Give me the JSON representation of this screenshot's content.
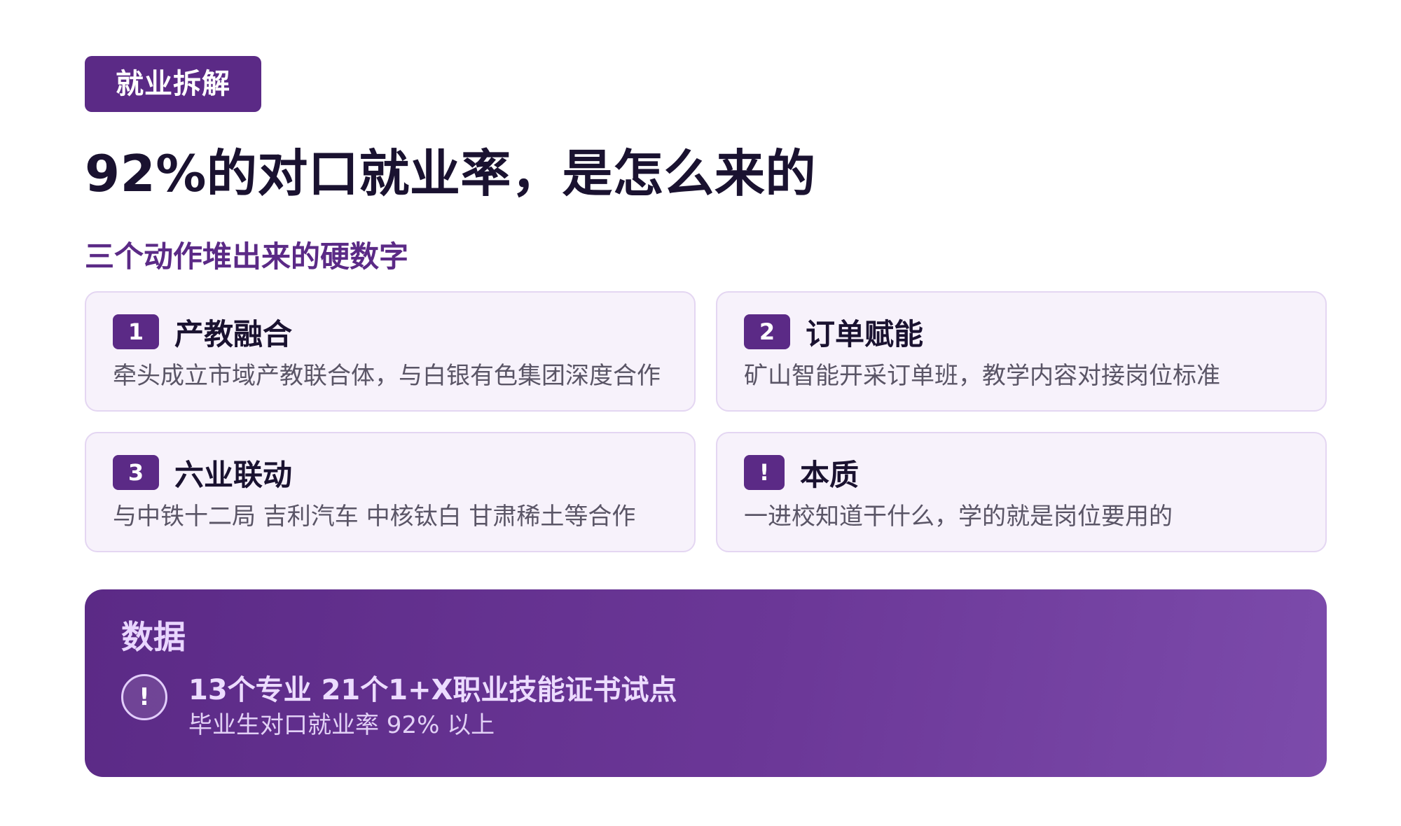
{
  "header": {
    "tag": "就业拆解",
    "title": "92%的对口就业率，是怎么来的",
    "subtitle": "三个动作堆出来的硬数字"
  },
  "cards": [
    {
      "badge": "1",
      "title": "产教融合",
      "desc": "牵头成立市域产教联合体，与白银有色集团深度合作"
    },
    {
      "badge": "2",
      "title": "订单赋能",
      "desc": "矿山智能开采订单班，教学内容对接岗位标准"
    },
    {
      "badge": "3",
      "title": "六业联动",
      "desc": "与中铁十二局 吉利汽车 中核钛白 甘肃稀土等合作"
    },
    {
      "badge": "!",
      "title": "本质",
      "desc": "一进校知道干什么，学的就是岗位要用的"
    }
  ],
  "data_panel": {
    "title": "数据",
    "icon": "!",
    "main": "13个专业 21个1+X职业技能证书试点",
    "sub": "毕业生对口就业率 92% 以上"
  },
  "colors": {
    "accent": "#5b2a86",
    "card_bg": "#f7f2fb",
    "card_border": "#e4d6f2",
    "title_text": "#1a1230"
  }
}
